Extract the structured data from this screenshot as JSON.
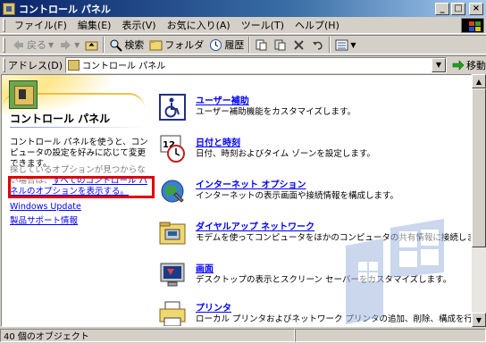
{
  "window": {
    "title": "コントロール パネル"
  },
  "menu": [
    "ファイル(F)",
    "編集(E)",
    "表示(V)",
    "お気に入り(A)",
    "ツール(T)",
    "ヘルプ(H)"
  ],
  "toolbar": {
    "back": "戻る",
    "search": "検索",
    "folders": "フォルダ",
    "history": "履歴"
  },
  "address": {
    "label": "アドレス(D)",
    "value": "コントロール パネル",
    "go": "移動"
  },
  "left": {
    "title": "コントロール パネル",
    "description": "コントロール パネルを使うと、コンピュータの設定を好みに応じて変更できます。",
    "note_prefix": "探しているオプションが見つからない場合は、",
    "note_link": "すべてのコントロール パネルのオプションを表示する。",
    "link_windows_update": "Windows Update",
    "link_support": "製品サポート情報"
  },
  "items": [
    {
      "title": "ユーザー補助",
      "desc": "ユーザー補助機能をカスタマイズします。",
      "icon": "accessibility-icon"
    },
    {
      "title": "日付と時刻",
      "desc": "日付、時刻およびタイム ゾーンを設定します。",
      "icon": "date-time-icon"
    },
    {
      "title": "インターネット オプション",
      "desc": "インターネットの表示画面や接続情報を構成します。",
      "icon": "internet-options-icon"
    },
    {
      "title": "ダイヤルアップ ネットワーク",
      "desc": "モデムを使ってコンピュータをほかのコンピュータの共有情報に接続します。",
      "icon": "dialup-network-icon"
    },
    {
      "title": "画面",
      "desc": "デスクトップの表示とスクリーン セーバーをカスタマイズします。",
      "icon": "display-icon"
    },
    {
      "title": "プリンタ",
      "desc": "ローカル プリンタおよびネットワーク プリンタの追加、削除、構成を行います。",
      "icon": "printer-icon"
    }
  ],
  "status": {
    "objects": "40 個のオブジェクト"
  }
}
